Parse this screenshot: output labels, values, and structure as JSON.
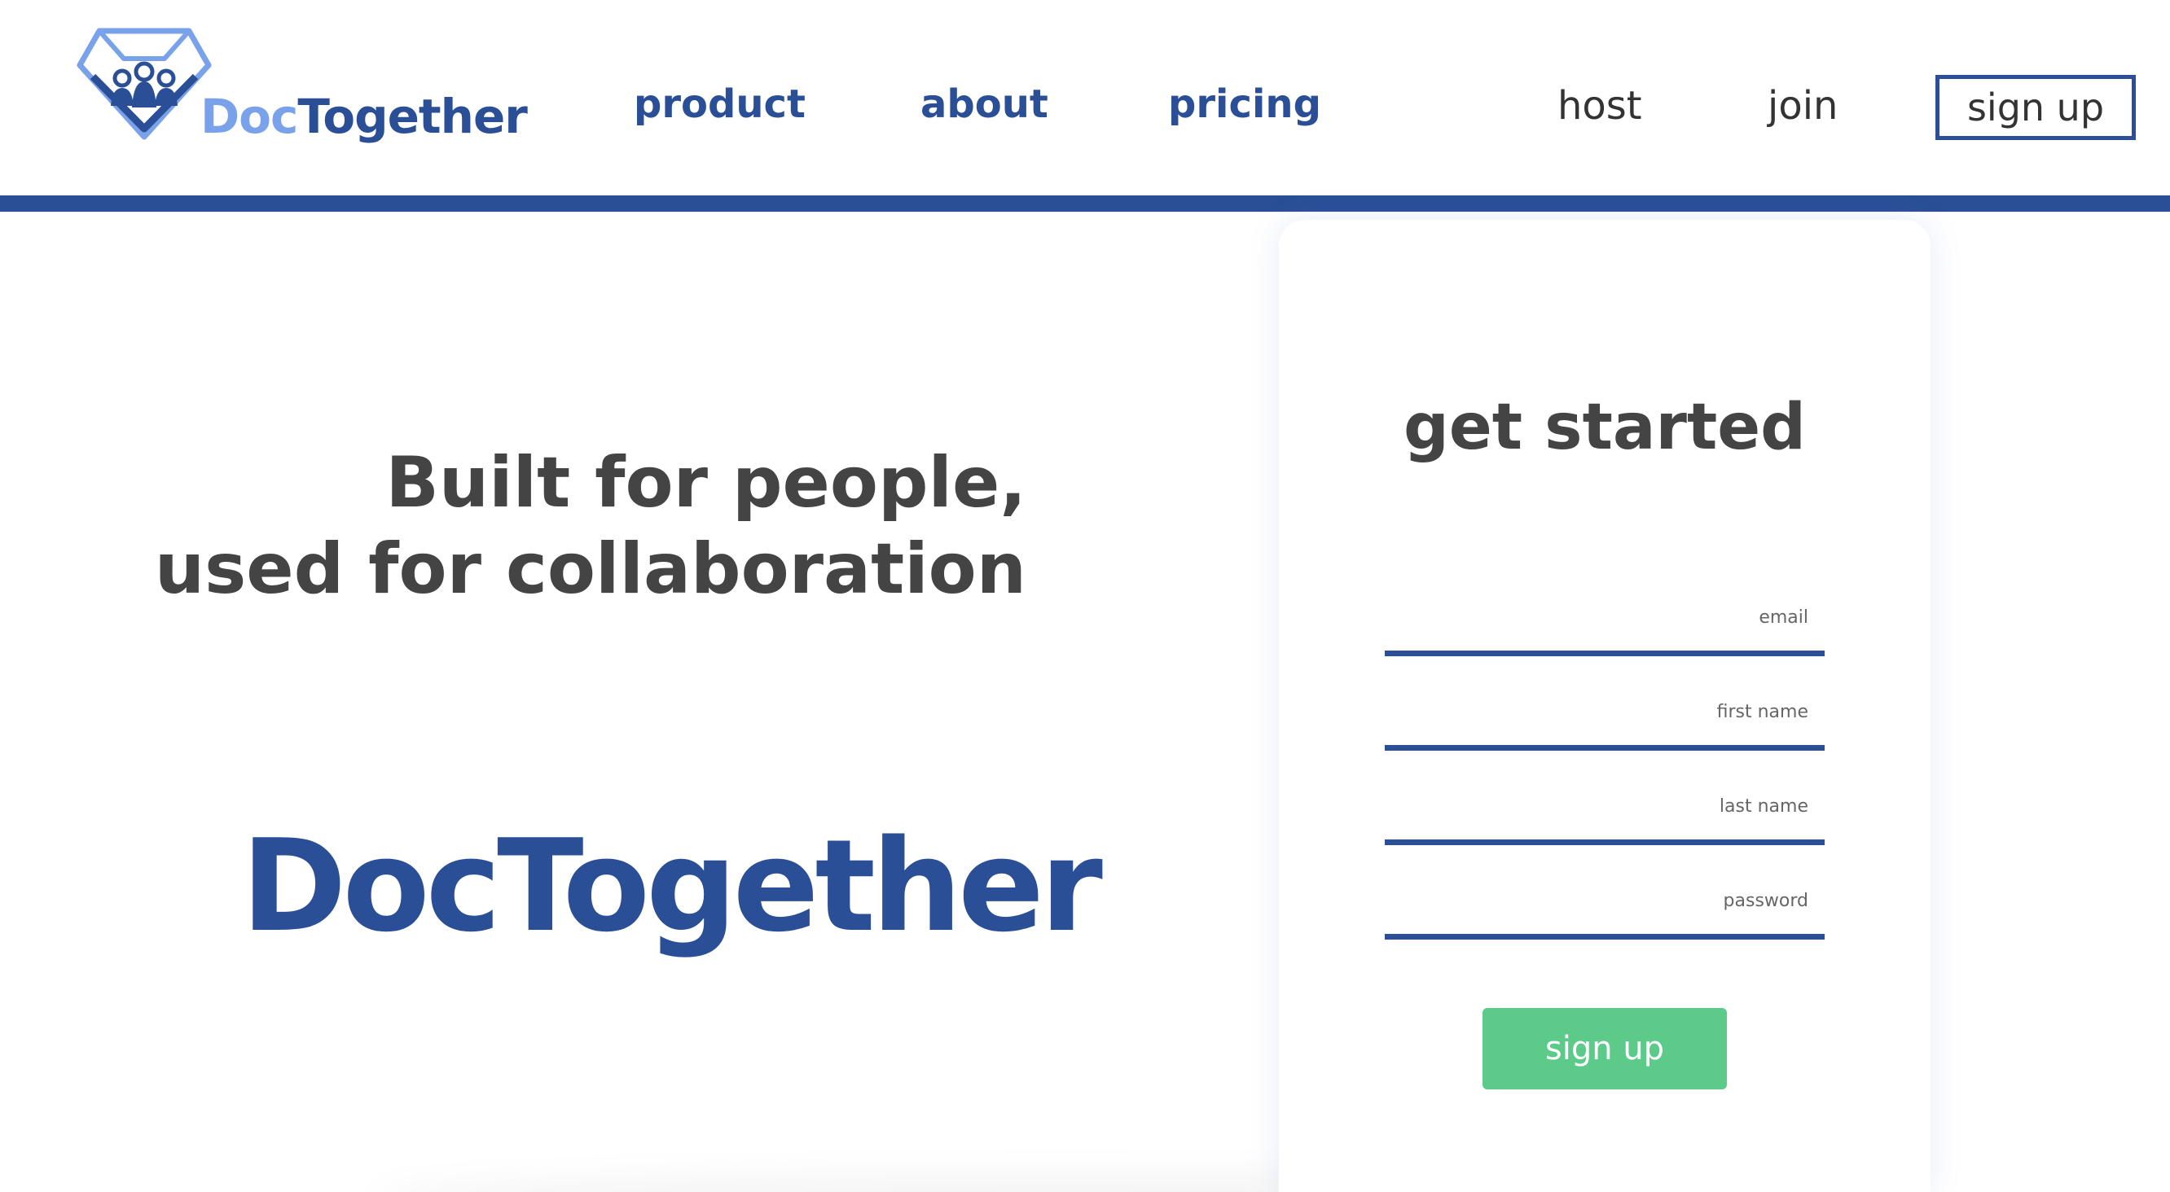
{
  "header": {
    "logo": {
      "text_part1": "Doc",
      "text_part2": "Together"
    },
    "nav": {
      "product": "product",
      "about": "about",
      "pricing": "pricing",
      "host": "host",
      "join": "join",
      "signup": "sign up"
    }
  },
  "hero": {
    "tagline_line1": "Built for people,",
    "tagline_line2": "used for collaboration",
    "brand": "DocTogether"
  },
  "signup_card": {
    "title": "get started",
    "fields": {
      "email": {
        "label": "email",
        "value": ""
      },
      "first_name": {
        "label": "first name",
        "value": ""
      },
      "last_name": {
        "label": "last name",
        "value": ""
      },
      "password": {
        "label": "password",
        "value": ""
      }
    },
    "submit_label": "sign up"
  },
  "colors": {
    "brand_blue": "#2a4f96",
    "logo_light_blue": "#7aa2ea",
    "heading_gray": "#444444",
    "submit_green": "#5ccb8a"
  },
  "icons": {
    "logo_mark": "diamond-people-icon"
  }
}
